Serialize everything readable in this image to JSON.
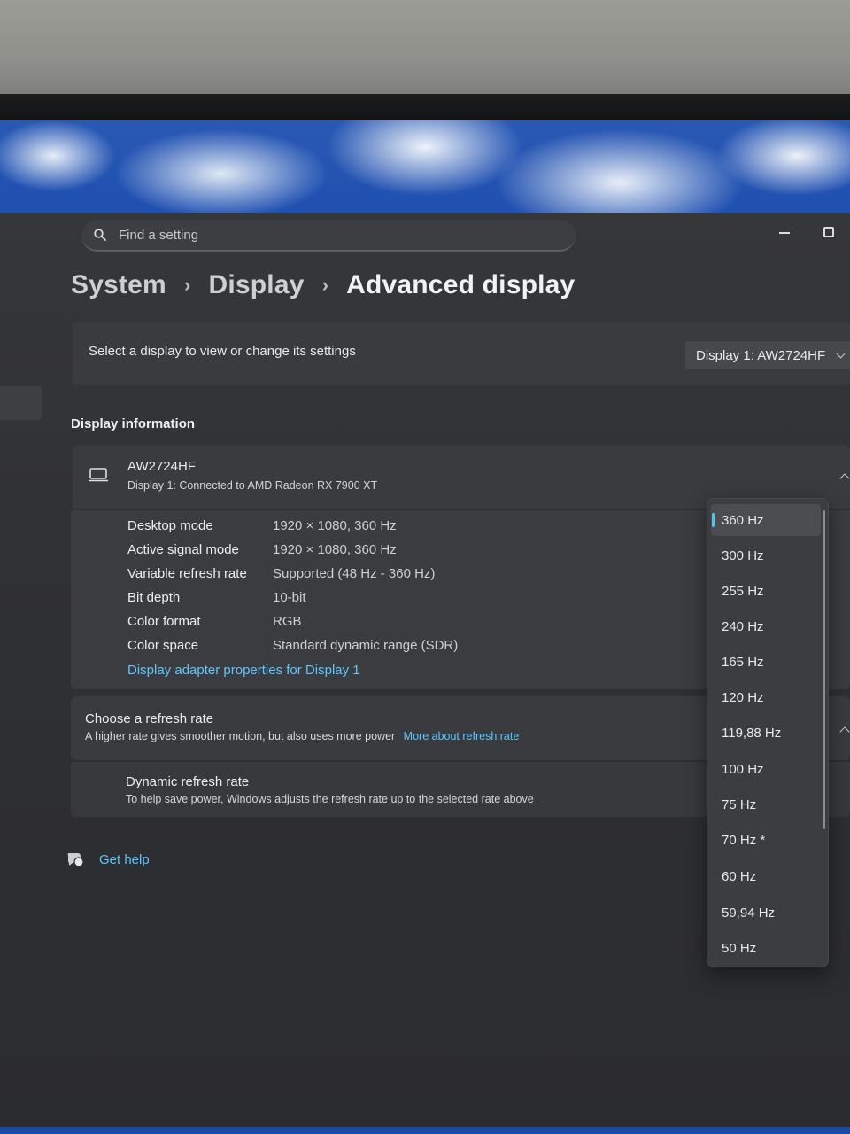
{
  "search": {
    "placeholder": "Find a setting"
  },
  "breadcrumb": {
    "system": "System",
    "display": "Display",
    "current": "Advanced display"
  },
  "select_display": {
    "label": "Select a display to view or change its settings",
    "selected": "Display 1: AW2724HF"
  },
  "display_info": {
    "section_title": "Display information",
    "monitor_name": "AW2724HF",
    "monitor_subtitle": "Display 1: Connected to AMD Radeon RX 7900 XT",
    "properties": [
      {
        "key": "Desktop mode",
        "value": "1920 × 1080, 360 Hz"
      },
      {
        "key": "Active signal mode",
        "value": "1920 × 1080, 360 Hz"
      },
      {
        "key": "Variable refresh rate",
        "value": "Supported (48 Hz - 360 Hz)"
      },
      {
        "key": "Bit depth",
        "value": "10-bit"
      },
      {
        "key": "Color format",
        "value": "RGB"
      },
      {
        "key": "Color space",
        "value": "Standard dynamic range (SDR)"
      }
    ],
    "adapter_link": "Display adapter properties for Display 1"
  },
  "refresh_rate": {
    "title": "Choose a refresh rate",
    "subtitle": "A higher rate gives smoother motion, but also uses more power",
    "link": "More about refresh rate",
    "dynamic_title": "Dynamic refresh rate",
    "dynamic_subtitle": "To help save power, Windows adjusts the refresh rate up to the selected rate above",
    "options": [
      "360 Hz",
      "300 Hz",
      "255 Hz",
      "240 Hz",
      "165 Hz",
      "120 Hz",
      "119,88 Hz",
      "100 Hz",
      "75 Hz",
      "70 Hz *",
      "60 Hz",
      "59,94 Hz",
      "50 Hz"
    ],
    "selected": "360 Hz"
  },
  "help": {
    "label": "Get help"
  },
  "colors": {
    "accent": "#4cc2ff",
    "link": "#5cc6ff",
    "card": "#3a3b3e"
  }
}
